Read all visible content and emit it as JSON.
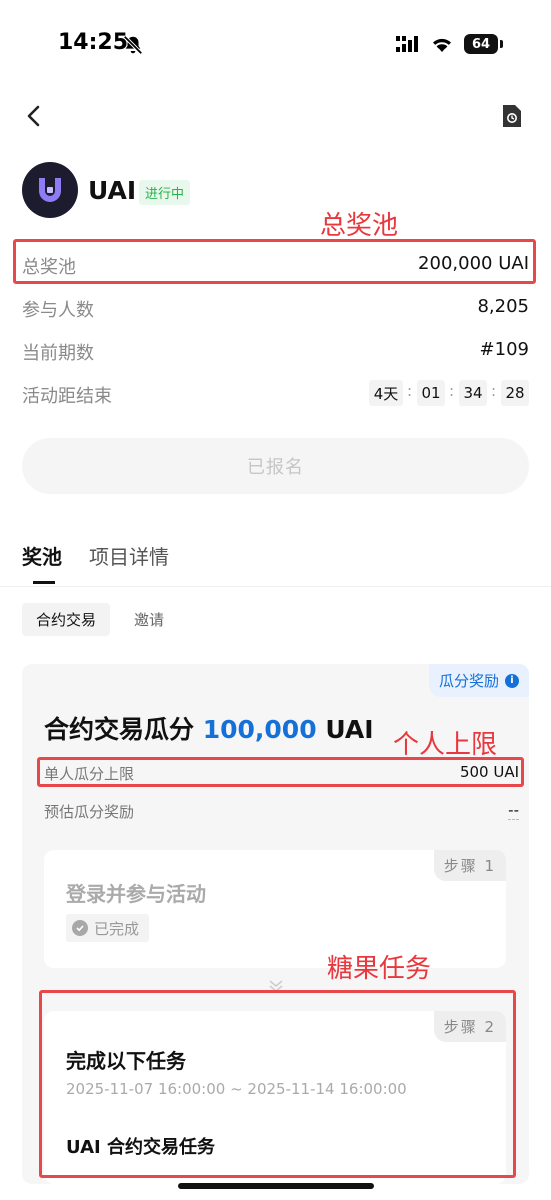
{
  "status_bar": {
    "time": "14:25",
    "battery": "64"
  },
  "header": {
    "token": "UAI",
    "badge": "进行中"
  },
  "annotations": {
    "pool": "总奖池",
    "personal_cap": "个人上限",
    "candy_task": "糖果任务"
  },
  "stats": [
    {
      "label": "总奖池",
      "value": "200,000 UAI"
    },
    {
      "label": "参与人数",
      "value": "8,205"
    },
    {
      "label": "当前期数",
      "value": "#109"
    },
    {
      "label": "活动距结束",
      "value": ""
    }
  ],
  "countdown": {
    "days": "4天",
    "hours": "01",
    "minutes": "34",
    "seconds": "28",
    "sep": ":"
  },
  "register_button": "已报名",
  "tabs": [
    "奖池",
    "项目详情"
  ],
  "subtabs": [
    "合约交易",
    "邀请"
  ],
  "pool_card": {
    "tag": "瓜分奖励",
    "info": "i",
    "title_prefix": "合约交易瓜分",
    "title_amount": "100,000",
    "title_unit": "UAI",
    "cap_label": "单人瓜分上限",
    "cap_value": "500 UAI",
    "est_label": "预估瓜分奖励",
    "est_value": "--"
  },
  "step1": {
    "tag": "步骤 1",
    "title": "登录并参与活动",
    "status": "已完成"
  },
  "step2": {
    "tag": "步骤 2",
    "title": "完成以下任务",
    "time_range": "2025-11-07 16:00:00 ~ 2025-11-14 16:00:00",
    "task_name": "UAI 合约交易任务"
  }
}
